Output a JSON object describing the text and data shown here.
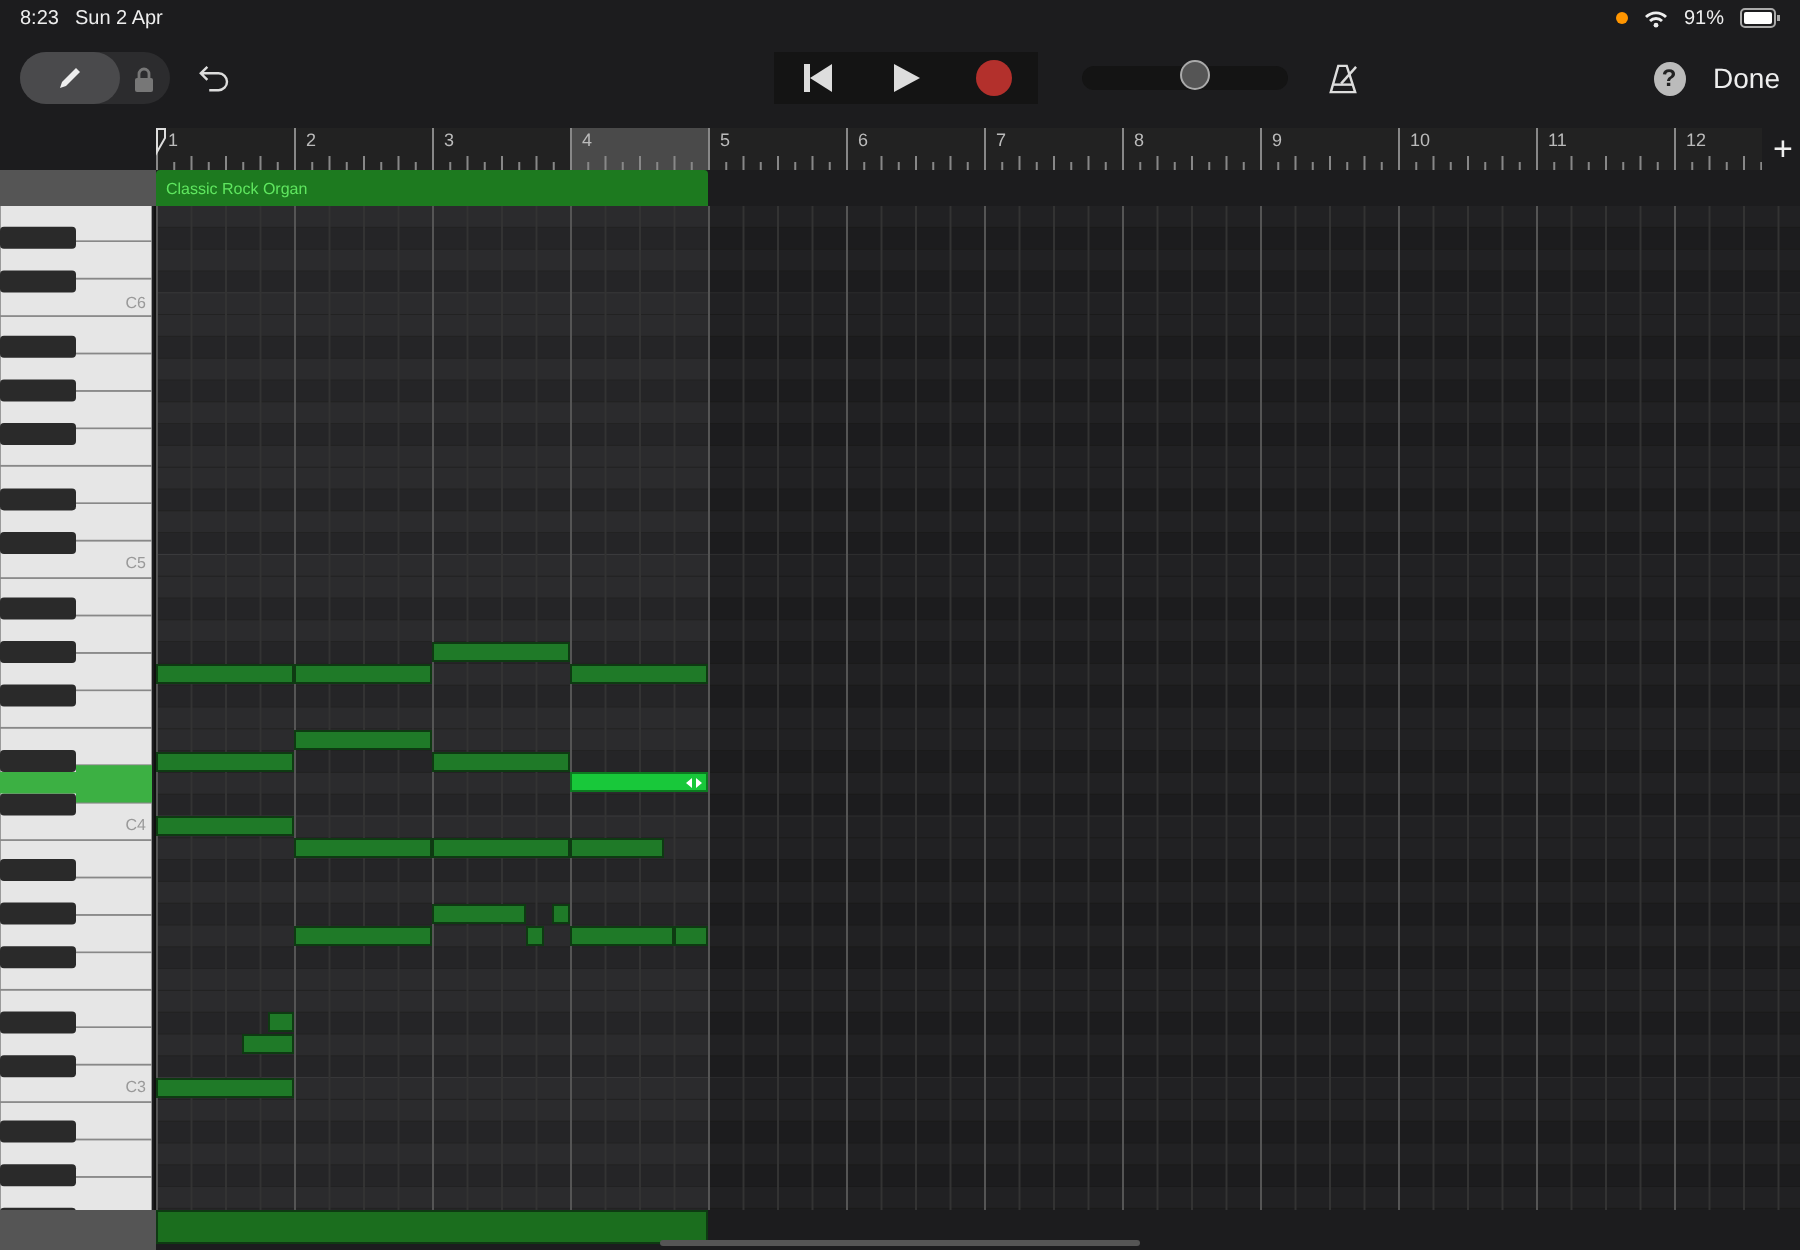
{
  "status_bar": {
    "time": "8:23",
    "date": "Sun 2 Apr",
    "battery": "91%"
  },
  "toolbar": {
    "pencil_mode": {
      "on": true
    },
    "volume": {
      "level": 0.55
    },
    "help": "?",
    "done": "Done"
  },
  "ruler": {
    "bars": [
      {
        "label": "1",
        "selected": false
      },
      {
        "label": "2",
        "selected": false
      },
      {
        "label": "3",
        "selected": false
      },
      {
        "label": "4",
        "selected": true
      },
      {
        "label": "5",
        "selected": false
      },
      {
        "label": "6",
        "selected": false
      },
      {
        "label": "7",
        "selected": false
      },
      {
        "label": "8",
        "selected": false
      },
      {
        "label": "9",
        "selected": false
      },
      {
        "label": "10",
        "selected": false
      },
      {
        "label": "11",
        "selected": false
      },
      {
        "label": "12",
        "selected": false
      }
    ],
    "add": "+"
  },
  "region": {
    "name": "Classic Rock Organ"
  },
  "keyboard": {
    "labels": [
      "C6",
      "C5",
      "C4",
      "C3"
    ]
  },
  "notes": [
    {
      "selected": false
    },
    {
      "selected": false
    },
    {
      "selected": false
    },
    {
      "selected": false
    },
    {
      "selected": false
    },
    {
      "selected": false
    },
    {
      "selected": false
    },
    {
      "selected": true
    },
    {
      "selected": false
    },
    {
      "selected": false
    },
    {
      "selected": false
    },
    {
      "selected": false
    },
    {
      "selected": false
    },
    {
      "selected": false
    },
    {
      "selected": false
    },
    {
      "selected": false
    },
    {
      "selected": false
    },
    {
      "selected": false
    },
    {
      "selected": false
    },
    {
      "selected": false
    },
    {
      "selected": false
    }
  ]
}
